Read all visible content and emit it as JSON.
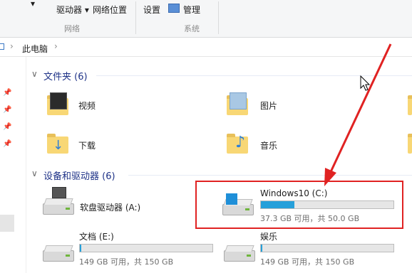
{
  "ribbon": {
    "map_drive_label": "驱动器",
    "network_location_label": "网络位置",
    "network_group": "网络",
    "settings_label": "设置",
    "manage_label": "管理",
    "system_group": "系统"
  },
  "address": {
    "path_label": "此电脑",
    "chevron": "›"
  },
  "folders_section": {
    "title": "文件夹 (6)"
  },
  "folders": [
    {
      "name": "视频",
      "icon": "video-folder-icon"
    },
    {
      "name": "图片",
      "icon": "pictures-folder-icon"
    },
    {
      "name": "下载",
      "icon": "downloads-folder-icon"
    },
    {
      "name": "音乐",
      "icon": "music-folder-icon"
    }
  ],
  "drives_section": {
    "title": "设备和驱动器 (6)"
  },
  "drives": [
    {
      "name": "软盘驱动器 (A:)",
      "icon": "floppy-drive-icon"
    },
    {
      "name": "Windows10 (C:)",
      "space": "37.3 GB 可用，共 50.0 GB",
      "used_fraction": 0.254,
      "icon": "windows-drive-icon"
    },
    {
      "name": "文档 (E:)",
      "space": "149 GB 可用，共 150 GB",
      "used_fraction": 0.01,
      "icon": "hard-drive-icon"
    },
    {
      "name": "娱乐",
      "space": "149 GB 可用，共 150 GB",
      "used_fraction": 0.01,
      "icon": "hard-drive-icon"
    }
  ],
  "colors": {
    "accent": "#26a0da",
    "highlight": "#e02222",
    "section_title": "#1e3287"
  }
}
